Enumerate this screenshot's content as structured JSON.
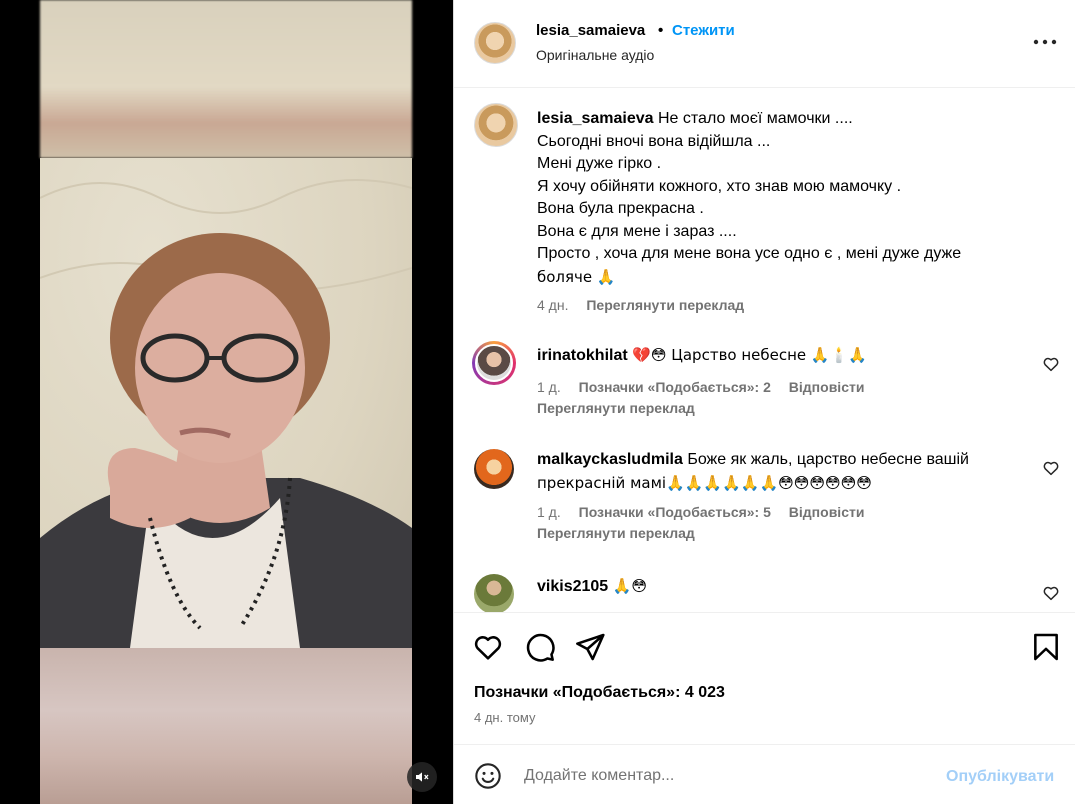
{
  "post": {
    "username": "lesia_samaieva",
    "separator": "•",
    "follow_label": "Стежити",
    "audio_label": "Оригінальне аудіо"
  },
  "caption": {
    "username": "lesia_samaieva",
    "lines": [
      "Не стало моєї мамочки ....",
      "Сьогодні вночі вона відійшла ...",
      "Мені дуже гірко .",
      "Я хочу обійняти кожного, хто знав мою мамочку .",
      "Вона була прекрасна .",
      "Вона є для мене і зараз ....",
      "Просто , хоча для мене вона усе одно є , мені дуже дуже",
      "боляче 🙏"
    ],
    "time": "4 дн.",
    "translation_label": "Переглянути переклад"
  },
  "comments": [
    {
      "username": "irinatokhilat",
      "text": "💔😳 Царство небесне 🙏🕯️🙏",
      "time": "1 д.",
      "likes_label": "Позначки «Подобається»: 2",
      "reply_label": "Відповісти",
      "translation_label": "Переглянути переклад"
    },
    {
      "username": "malkayckasludmila",
      "text_line1": "Боже як жаль, царство небесне вашій",
      "text_line2": "прекрасній мамі🙏🙏🙏🙏🙏🙏😳😳😳😳😳😳",
      "time": "1 д.",
      "likes_label": "Позначки «Подобається»: 5",
      "reply_label": "Відповісти",
      "translation_label": "Переглянути переклад"
    },
    {
      "username": "vikis2105",
      "text": "🙏😳"
    }
  ],
  "footer": {
    "likes": "Позначки «Подобається»: 4 023",
    "time": "4 дн. тому",
    "comment_placeholder": "Додайте коментар...",
    "publish_label": "Опублікувати"
  },
  "colors": {
    "accent": "#0095f6",
    "muted": "#737373",
    "publish_disabled": "#a3cff8"
  },
  "icons": [
    "heart-icon",
    "comment-icon",
    "share-icon",
    "bookmark-icon",
    "more-icon",
    "emoji-icon",
    "mute-icon"
  ]
}
